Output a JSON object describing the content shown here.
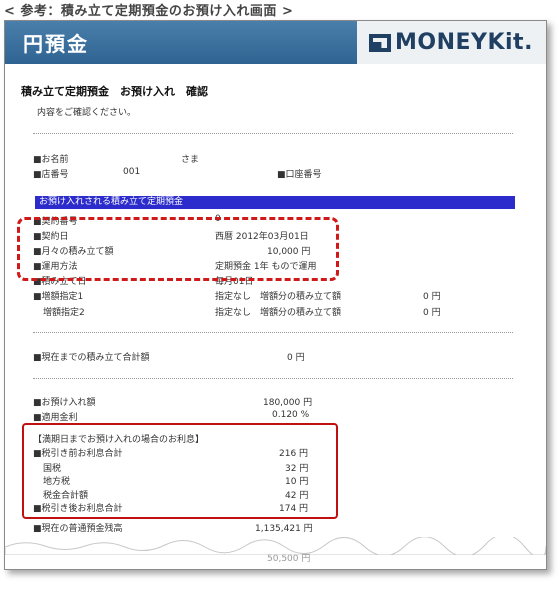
{
  "caption": "< 参考：積み立て定期預金のお預け入れ画面 >",
  "header": {
    "title": "円預金",
    "logo": "MONEYKit."
  },
  "page_title": "積み立て定期預金　お預け入れ　確認",
  "intro": "内容をご確認ください。",
  "customer": {
    "name_label": "■お名前",
    "name_suffix": "さま",
    "branch_label": "■店番号",
    "branch_value": "001",
    "account_label": "■口座番号"
  },
  "section_bar": "お預け入れされる積み立て定期預金",
  "details": [
    {
      "label": "■契約番号",
      "value": "0"
    },
    {
      "label": "■契約日",
      "value": "西暦 2012年03月01日"
    },
    {
      "label": "■月々の積み立て額",
      "value": "10,000 円"
    },
    {
      "label": "■運用方法",
      "value": "定期預金 1年 もので運用"
    },
    {
      "label": "■積み立て日",
      "value": "毎月01日"
    }
  ],
  "increments": [
    {
      "label": "■増額指定1",
      "value": "指定なし　増額分の積み立て額",
      "amount": "0 円"
    },
    {
      "label": "増額指定2",
      "value": "指定なし　増額分の積み立て額",
      "amount": "0 円"
    }
  ],
  "total_so_far": {
    "label": "■現在までの積み立て合計額",
    "value": "0 円"
  },
  "deposit": [
    {
      "label": "■お預け入れ額",
      "value": "180,000 円"
    },
    {
      "label": "■適用金利",
      "value": "0.120 %"
    }
  ],
  "maturity_heading": "【満期日までお預け入れの場合のお利息】",
  "maturity": [
    {
      "label": "■税引き前お利息合計",
      "value": "216 円"
    },
    {
      "label": "国税",
      "value": "32 円"
    },
    {
      "label": "地方税",
      "value": "10 円"
    },
    {
      "label": "税金合計額",
      "value": "42 円"
    },
    {
      "label": "■税引き後お利息合計",
      "value": "174 円"
    }
  ],
  "balance": {
    "label": "■現在の普通預金残高",
    "value": "1,135,421 円"
  },
  "truncated": "50,500 円"
}
